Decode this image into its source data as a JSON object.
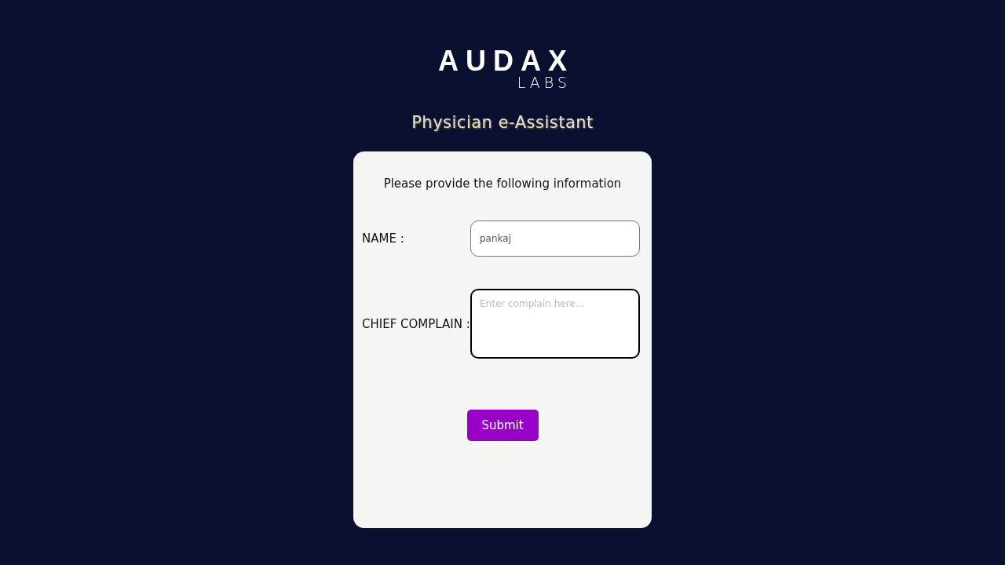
{
  "logo": {
    "word": "AUDAX",
    "sub": "LABS"
  },
  "title": "Physician e-Assistant",
  "form": {
    "heading": "Please provide the following information",
    "fields": [
      {
        "kind": "input",
        "label": "NAME :",
        "value": "pankaj",
        "focused": false
      },
      {
        "kind": "textarea",
        "label": "CHIEF COMPLAIN :",
        "placeholder": "Enter complain here...",
        "focused": true
      }
    ],
    "submit": "Submit"
  }
}
